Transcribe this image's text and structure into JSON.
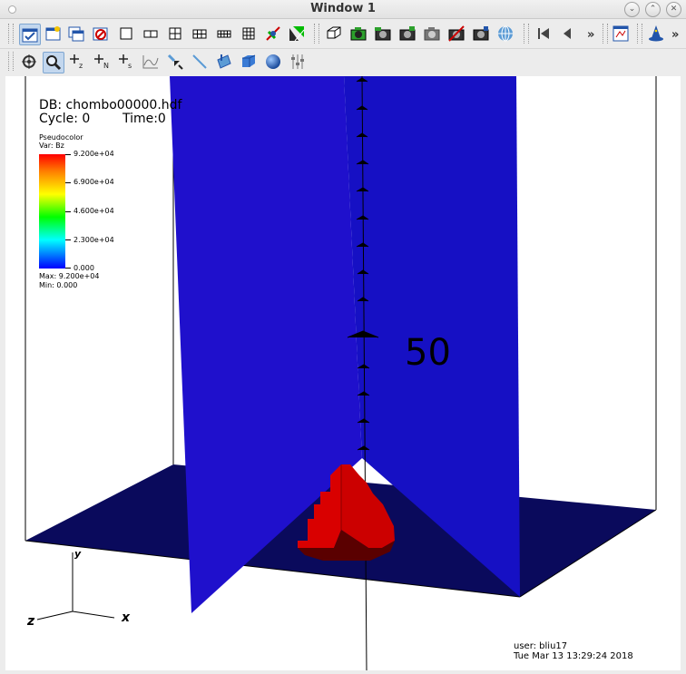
{
  "window": {
    "title": "Window 1"
  },
  "toolbar": {
    "overflow_label_1": "»",
    "overflow_label_2": "»"
  },
  "plot": {
    "db": "DB: chombo00000.hdf",
    "cycle": "Cycle: 0",
    "time": "Time:0",
    "legend": {
      "title": "Pseudocolor",
      "var": "Var: Bz",
      "ticks": [
        "9.200e+04",
        "6.900e+04",
        "4.600e+04",
        "2.300e+04",
        "0.000"
      ],
      "max": "Max:  9.200e+04",
      "min": "Min:  0.000"
    },
    "slab_label": "50",
    "axes": {
      "x": "x",
      "y": "y",
      "z": "z"
    },
    "user": "user: bliu17",
    "date": "Tue Mar 13 13:29:24 2018",
    "colors": {
      "slab": "#1a10cc",
      "floor": "#0a0a5c",
      "blob": "#cc0000",
      "blob_shadow": "#5a0000"
    }
  }
}
